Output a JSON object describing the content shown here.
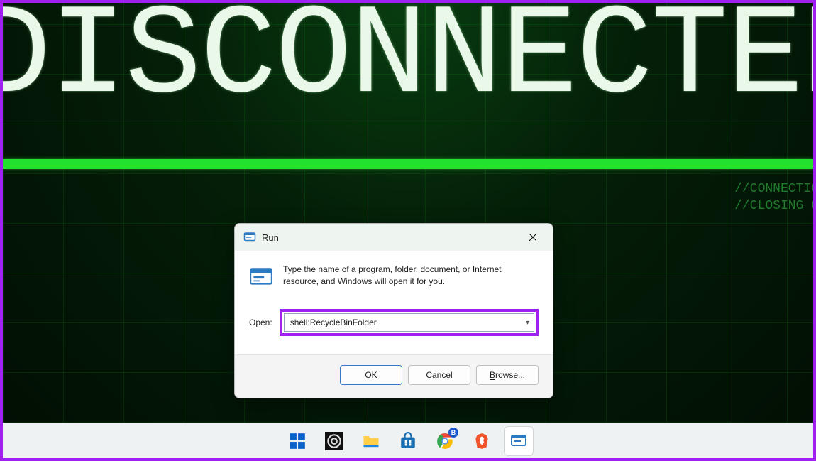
{
  "wallpaper": {
    "hero_text": "DISCONNECTED",
    "sub1": "//CONNECTIO",
    "sub2": "//CLOSING O"
  },
  "run": {
    "title": "Run",
    "description": "Type the name of a program, folder, document, or Internet resource, and Windows will open it for you.",
    "open_label": "Open:",
    "open_value": "shell:RecycleBinFolder",
    "ok": "OK",
    "cancel": "Cancel",
    "browse": "Browse..."
  },
  "icons": {
    "run_small": "run-window-icon",
    "run_big": "run-window-icon",
    "close": "close-icon",
    "chevron": "chevron-down-icon"
  },
  "taskbar": {
    "items": [
      "start",
      "obs",
      "explorer",
      "msstore",
      "chrome",
      "brave",
      "run"
    ]
  }
}
